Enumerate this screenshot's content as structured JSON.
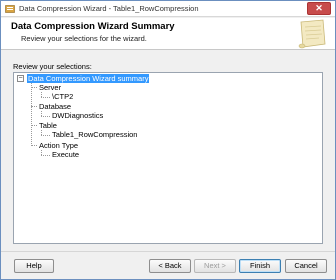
{
  "window": {
    "title": "Data Compression Wizard - Table1_RowCompression",
    "close_glyph": "✕"
  },
  "header": {
    "title": "Data Compression Wizard Summary",
    "subtitle": "Review your selections for the wizard."
  },
  "review_label": "Review your selections:",
  "tree": {
    "root": "Data Compression Wizard summary",
    "server_label": "Server",
    "server_value": "\\CTP2",
    "database_label": "Database",
    "database_value": "DWDiagnostics",
    "table_label": "Table",
    "table_value": "Table1_RowCompression",
    "action_label": "Action Type",
    "action_value": "Execute",
    "collapse_glyph": "−"
  },
  "buttons": {
    "help": "Help",
    "back": "< Back",
    "next": "Next >",
    "finish": "Finish",
    "cancel": "Cancel"
  },
  "colors": {
    "selection": "#3399ff",
    "close": "#c74b4b"
  }
}
